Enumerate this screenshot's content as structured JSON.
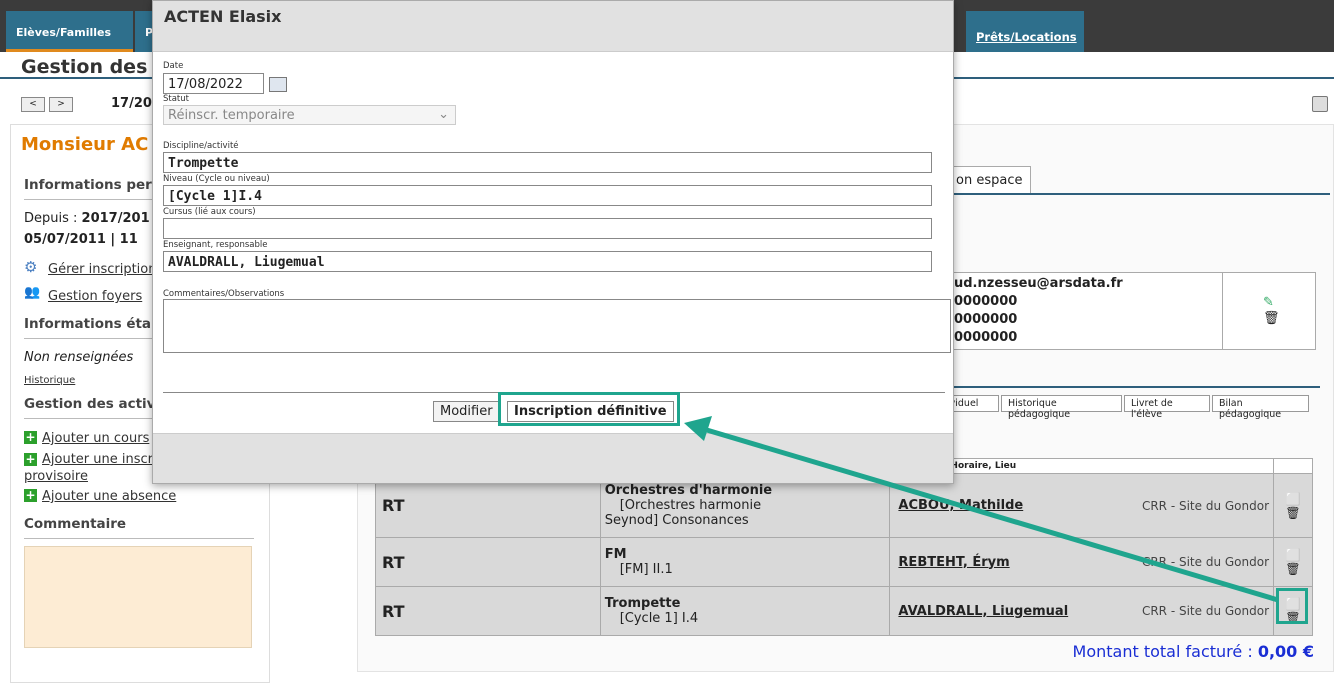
{
  "nav": {
    "tab_eleves": "Elèves/Familles",
    "tab_p": "P",
    "tab_prets": "Prêts/Locations"
  },
  "page": {
    "title": "Gestion des é",
    "date_partial": "17/20",
    "prev": "<",
    "next": ">"
  },
  "left": {
    "name": "Monsieur AC",
    "info_pers": "Informations per",
    "since_label": "Depuis :",
    "since_val": "2017/201",
    "birth": "05/07/2011 | 11",
    "gerer": "Gérer inscription",
    "foyers": "Gestion foyers",
    "info_etab": "Informations éta",
    "non_renseignees": "Non renseignées",
    "historique": "Historique",
    "gestion_activ": "Gestion des activ",
    "ajouter_cours": "Ajouter un cours",
    "ajouter_inscr": "Ajouter une inscr",
    "provisoire": "provisoire",
    "ajouter_absence": "Ajouter une absence",
    "commentaire": "Commentaire"
  },
  "right": {
    "mon_espace": "on espace",
    "email": "ud.nzesseu@arsdata.fr",
    "phone1": "0000000",
    "phone2": "0000000",
    "phone3": "0000000",
    "tabs": [
      "ividuel",
      "Historique pédagogique",
      "Livret de l'élève",
      "Bilan pédagogique"
    ],
    "col_horaire": "Horaire, Lieu",
    "rows": [
      {
        "code": "RT",
        "discipline": "Orchestres d'harmonie",
        "detail1": "[Orchestres harmonie",
        "detail2": "Seynod] Consonances",
        "prof": "ACBOU, Mathilde",
        "site": "CRR - Site du Gondor"
      },
      {
        "code": "RT",
        "discipline": "FM",
        "detail1": "[FM] II.1",
        "detail2": "",
        "prof": "REBTEHT, Érym",
        "site": "CRR - Site du Gondor"
      },
      {
        "code": "RT",
        "discipline": "Trompette",
        "detail1": "[Cycle 1] I.4",
        "detail2": "",
        "prof": "AVALDRALL, Liugemual",
        "site": "CRR - Site du Gondor"
      }
    ],
    "total_label": "Montant total facturé :",
    "total_value": "0,00 €"
  },
  "modal": {
    "title": "ACTEN Elasix",
    "date_label": "Date",
    "date_value": "17/08/2022",
    "statut_label": "Statut",
    "statut_value": "Réinscr. temporaire",
    "discipline_label": "Discipline/activité",
    "discipline_value": "Trompette",
    "niveau_label": "Niveau (Cycle ou niveau)",
    "niveau_value": "[Cycle 1]I.4",
    "cursus_label": "Cursus (lié aux cours)",
    "cursus_value": "",
    "enseignant_label": "Enseignant, responsable",
    "enseignant_value": "AVALDRALL, Liugemual",
    "comment_label": "Commentaires/Observations",
    "btn_modifier": "Modifier",
    "btn_definitive": "Inscription définitive"
  },
  "colors": {
    "accent": "#1fa58e",
    "tab": "#2e6f8c",
    "orange": "#e07b00",
    "total": "#1a2ed4"
  }
}
